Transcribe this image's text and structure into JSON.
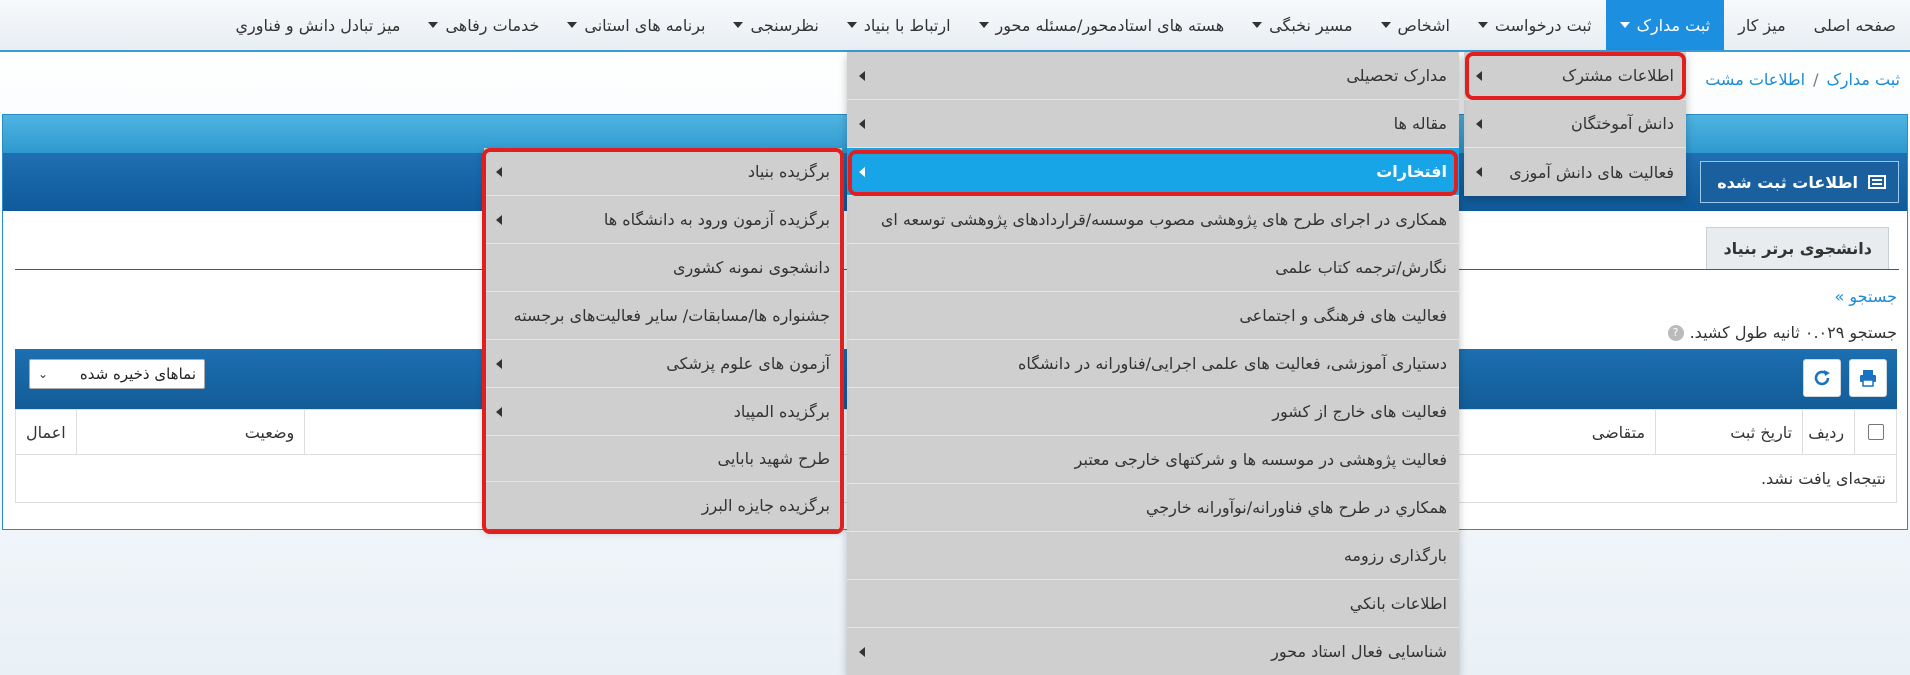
{
  "nav": {
    "items": [
      {
        "label": "صفحه اصلی",
        "caret": false
      },
      {
        "label": "میز کار",
        "caret": false
      },
      {
        "label": "ثبت مدارک",
        "caret": true,
        "active": true
      },
      {
        "label": "ثبت درخواست",
        "caret": true
      },
      {
        "label": "اشخاص",
        "caret": true
      },
      {
        "label": "مسیر نخبگی",
        "caret": true
      },
      {
        "label": "هسته های استادمحور/مسئله محور",
        "caret": true
      },
      {
        "label": "ارتباط با بنیاد",
        "caret": true
      },
      {
        "label": "نظرسنجی",
        "caret": true
      },
      {
        "label": "برنامه های استانی",
        "caret": true
      },
      {
        "label": "خدمات رفاهی",
        "caret": true
      },
      {
        "label": "میز تبادل دانش و فناوري",
        "caret": false
      }
    ]
  },
  "breadcrumb": {
    "first": "ثبت مدارک",
    "sep": "/",
    "second": "اطلاعات مشت"
  },
  "panel": {
    "title": "اطلاعات ثبت شده",
    "tab": "دانشجوی برتر بنیاد",
    "search_link": "جستجو »",
    "search_time": "جستجو ۰.۰۲۹ ثانیه طول کشید.",
    "saved_views": "نماهای ذخیره شده",
    "columns": {
      "row": "ردیف",
      "date": "تاریخ ثبت",
      "applicant": "متقاضی",
      "status": "وضعیت",
      "actions": "اعمال"
    },
    "empty": "نتیجه‌ای یافت نشد."
  },
  "menu1": [
    {
      "label": "اطلاعات مشترک",
      "arrow": true
    },
    {
      "label": "دانش آموختگان",
      "arrow": true
    },
    {
      "label": "فعالیت های دانش آموزی",
      "arrow": true
    }
  ],
  "menu2": [
    {
      "label": "مدارک تحصیلی",
      "arrow": true
    },
    {
      "label": "مقاله ها",
      "arrow": true
    },
    {
      "label": "افتخارات",
      "arrow": true,
      "highlight": true
    },
    {
      "label": "همکاری در اجرای طرح های پژوهشی مصوب موسسه/قراردادهای پژوهشی توسعه ای",
      "arrow": false
    },
    {
      "label": "نگارش/ترجمه کتاب علمی",
      "arrow": false
    },
    {
      "label": "فعالیت های فرهنگی و اجتماعی",
      "arrow": false
    },
    {
      "label": "دستیاری آموزشی، فعالیت های علمی اجرایی/فناورانه در دانشگاه",
      "arrow": false
    },
    {
      "label": "فعالیت های خارج از کشور",
      "arrow": false
    },
    {
      "label": "فعالیت پژوهشی در موسسه ها و شرکتهای خارجی معتبر",
      "arrow": false
    },
    {
      "label": "همكاري در طرح هاي فناورانه/نوآورانه خارجي",
      "arrow": false
    },
    {
      "label": "بارگذاری رزومه",
      "arrow": false
    },
    {
      "label": "اطلاعات بانكي",
      "arrow": false
    },
    {
      "label": "شناسایی فعال استاد محور",
      "arrow": true
    }
  ],
  "menu3": [
    {
      "label": "برگزیده بنیاد",
      "arrow": true
    },
    {
      "label": "برگزیده آزمون ورود به دانشگاه ها",
      "arrow": true
    },
    {
      "label": "دانشجوی نمونه کشوری",
      "arrow": false
    },
    {
      "label": "جشنواره ها/مسابقات/ سایر فعالیت‌های برجسته",
      "arrow": false
    },
    {
      "label": "آزمون های علوم پزشکی",
      "arrow": true
    },
    {
      "label": "برگزیده المپیاد",
      "arrow": true
    },
    {
      "label": "طرح شهید بابایی",
      "arrow": false
    },
    {
      "label": "برگزیده جایزه البرز",
      "arrow": false
    }
  ],
  "colors": {
    "accent": "#1d8fe0",
    "highlight": "#17a5e8",
    "annotation": "#e02020"
  }
}
